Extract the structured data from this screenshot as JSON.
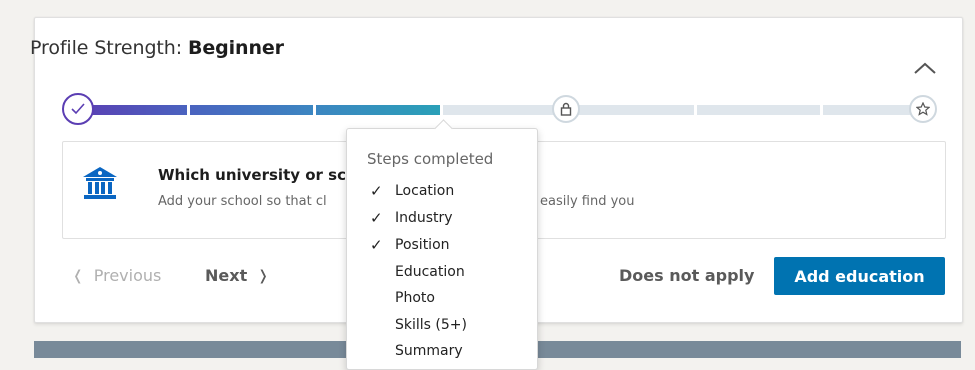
{
  "profile": {
    "title_prefix": "Profile Strength: ",
    "title_level": "Beginner",
    "progress_completed": 3,
    "progress_total": 7
  },
  "question": {
    "title_visible": "Which university or sc",
    "desc_left": "Add your school so that cl",
    "desc_right": "easily find you",
    "icon": "school-icon"
  },
  "nav": {
    "prev_label": "Previous",
    "next_label": "Next"
  },
  "actions": {
    "does_not_apply": "Does not apply",
    "add_education": "Add education"
  },
  "tooltip": {
    "title": "Steps completed",
    "steps": [
      {
        "label": "Location",
        "done": true
      },
      {
        "label": "Industry",
        "done": true
      },
      {
        "label": "Position",
        "done": true
      },
      {
        "label": "Education",
        "done": false
      },
      {
        "label": "Photo",
        "done": false
      },
      {
        "label": "Skills (5+)",
        "done": false
      },
      {
        "label": "Summary",
        "done": false
      }
    ]
  },
  "colors": {
    "brand_blue": "#0073b1",
    "progress_purple": "#5b3eb3",
    "progress_teal": "#2aa0b8",
    "progress_empty": "#dfe6ec"
  }
}
